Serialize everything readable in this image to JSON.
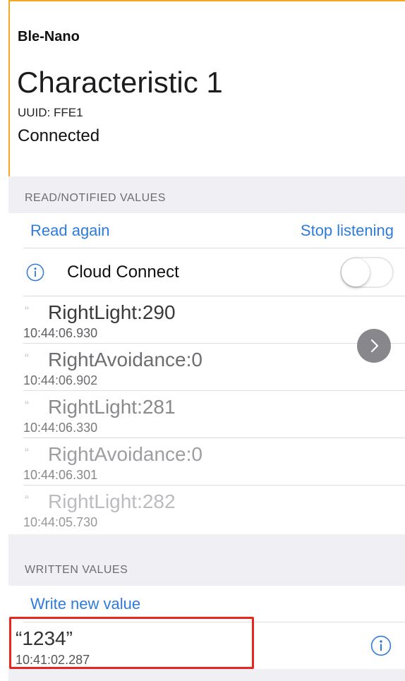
{
  "header": {
    "device_name": "Ble-Nano",
    "characteristic_title": "Characteristic 1",
    "uuid": "UUID: FFE1",
    "status": "Connected"
  },
  "read_section": {
    "title": "READ/NOTIFIED VALUES",
    "read_again_label": "Read again",
    "stop_listening_label": "Stop listening",
    "cloud_connect": {
      "label": "Cloud Connect",
      "icon": "info-icon",
      "enabled": false
    },
    "quote_glyph": "“",
    "next_icon": "chevron-right-icon",
    "values": [
      {
        "value": "RightLight:290",
        "time": "10:44:06.930"
      },
      {
        "value": "RightAvoidance:0",
        "time": "10:44:06.902"
      },
      {
        "value": "RightLight:281",
        "time": "10:44:06.330"
      },
      {
        "value": "RightAvoidance:0",
        "time": "10:44:06.301"
      },
      {
        "value": "RightLight:282",
        "time": "10:44:05.730"
      }
    ]
  },
  "written_section": {
    "title": "WRITTEN VALUES",
    "write_new_label": "Write new value",
    "values": [
      {
        "value": "“1234”",
        "time": "10:41:02.287",
        "icon": "info-icon"
      }
    ]
  },
  "colors": {
    "accent": "#2f7bdc",
    "highlight": "#e8251f",
    "frame": "#f5a623"
  }
}
